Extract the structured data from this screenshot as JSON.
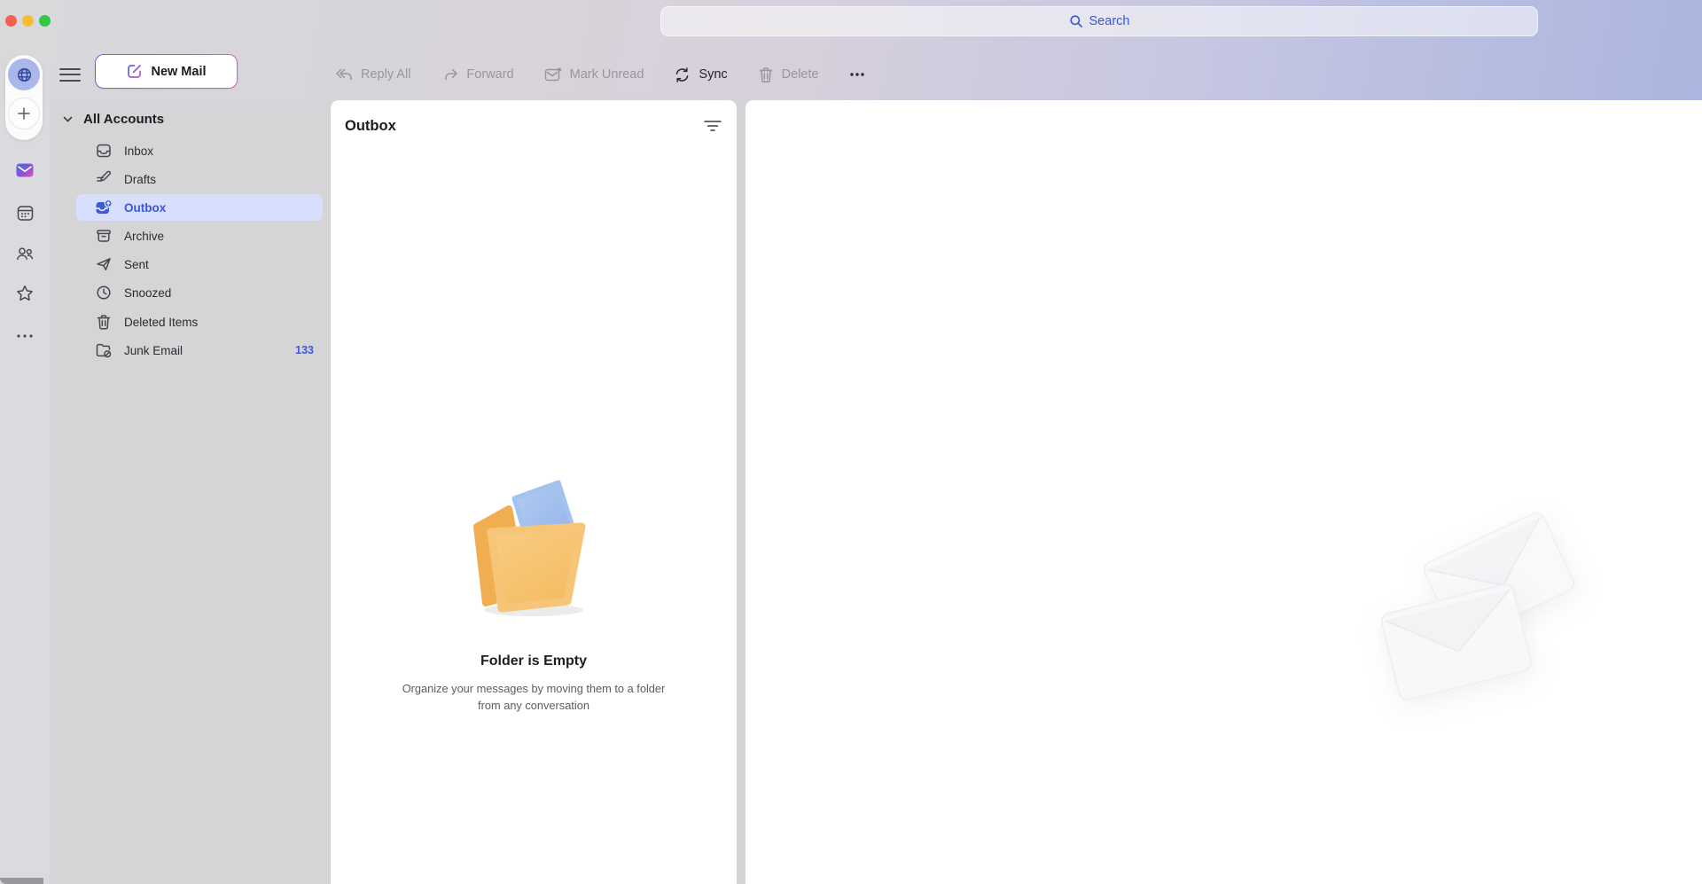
{
  "window": {
    "controls": [
      "close",
      "minimize",
      "zoom"
    ]
  },
  "header": {
    "search_label": "Search"
  },
  "rail": {
    "items": [
      "account-globe",
      "add-account",
      "mail",
      "calendar",
      "people",
      "favorites",
      "more-apps"
    ]
  },
  "sidebar": {
    "new_mail_label": "New Mail",
    "accounts_header": "All Accounts",
    "folders": [
      {
        "label": "Inbox",
        "icon": "inbox-icon",
        "selected": false
      },
      {
        "label": "Drafts",
        "icon": "drafts-icon",
        "selected": false
      },
      {
        "label": "Outbox",
        "icon": "outbox-icon",
        "selected": true
      },
      {
        "label": "Archive",
        "icon": "archive-icon",
        "selected": false
      },
      {
        "label": "Sent",
        "icon": "sent-icon",
        "selected": false
      },
      {
        "label": "Snoozed",
        "icon": "snoozed-icon",
        "selected": false
      },
      {
        "label": "Deleted Items",
        "icon": "deleted-items-icon",
        "selected": false
      },
      {
        "label": "Junk Email",
        "icon": "junk-email-icon",
        "selected": false,
        "count": "133"
      }
    ]
  },
  "toolbar": {
    "items": [
      {
        "label": "Reply All",
        "icon": "reply-all-icon",
        "enabled": false
      },
      {
        "label": "Forward",
        "icon": "forward-icon",
        "enabled": false
      },
      {
        "label": "Mark Unread",
        "icon": "mark-unread-icon",
        "enabled": false
      },
      {
        "label": "Sync",
        "icon": "sync-icon",
        "enabled": true
      },
      {
        "label": "Delete",
        "icon": "delete-icon",
        "enabled": false
      },
      {
        "label": "",
        "icon": "more-icon",
        "enabled": true
      }
    ]
  },
  "list_pane": {
    "title": "Outbox",
    "empty_state": {
      "title": "Folder is Empty",
      "subtitle": "Organize your messages by moving them to a folder from any conversation"
    }
  },
  "colors": {
    "accent_blue": "#3d5bd7",
    "selected_row_bg": "#d8dffc",
    "new_mail_gradient": [
      "#5a6de0",
      "#d163c2"
    ],
    "folder_illustration": [
      "#f2b157",
      "#f7c87c",
      "#a4c2ee"
    ]
  }
}
